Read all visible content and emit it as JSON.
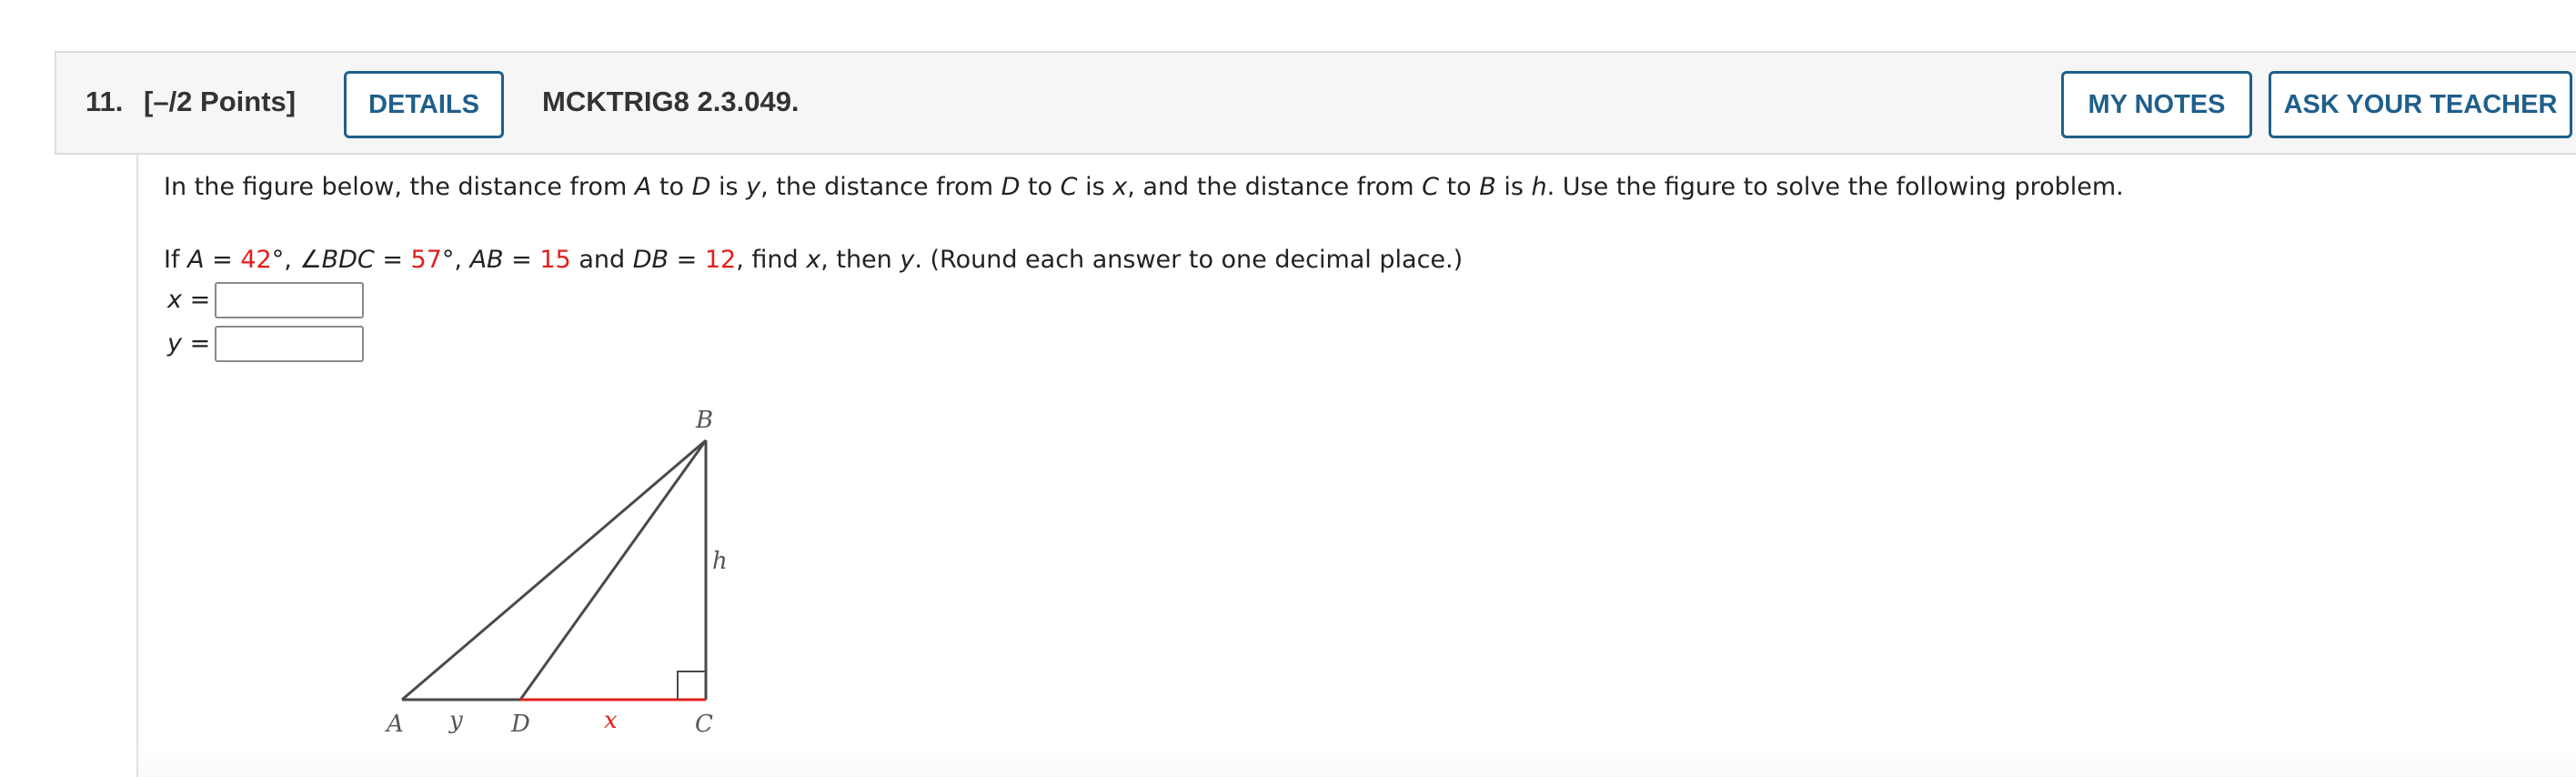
{
  "header": {
    "number": "11.",
    "points": "[–/2 Points]",
    "details_label": "DETAILS",
    "code": "MCKTRIG8 2.3.049.",
    "my_notes_label": "MY NOTES",
    "ask_teacher_label": "ASK YOUR TEACHER"
  },
  "problem": {
    "intro": {
      "p1": "In the figure below, the distance from ",
      "A": "A",
      "p2": " to ",
      "D": "D",
      "p3": " is ",
      "y": "y",
      "p4": ", the distance from ",
      "D2": "D",
      "p5": " to ",
      "C": "C",
      "p6": " is ",
      "x": "x",
      "p7": ", and the distance from ",
      "C2": "C",
      "p8": " to ",
      "B": "B",
      "p9": " is ",
      "h": "h",
      "p10": ". Use the figure to solve the following problem."
    },
    "given": {
      "p1": "If ",
      "A": "A",
      "p2": " = ",
      "A_val": "42",
      "p3": "°, ∠",
      "BDC": "BDC",
      "p4": " = ",
      "BDC_val": "57",
      "p5": "°, ",
      "AB": "AB",
      "p6": " = ",
      "AB_val": "15",
      "p7": " and ",
      "DB": "DB",
      "p8": " = ",
      "DB_val": "12",
      "p9": ", find ",
      "x": "x",
      "p10": ", then ",
      "y": "y",
      "p11": ". (Round each answer to one decimal place.)"
    },
    "answers": [
      {
        "var": "x",
        "eq": " =",
        "value": ""
      },
      {
        "var": "y",
        "eq": " =",
        "value": ""
      }
    ]
  },
  "figure": {
    "labels": {
      "A": "A",
      "B": "B",
      "C": "C",
      "D": "D",
      "h": "h",
      "x": "x",
      "y": "y"
    },
    "colors": {
      "line": "#4a4a4a",
      "highlight": "#e0201b",
      "text": "#555555"
    }
  }
}
